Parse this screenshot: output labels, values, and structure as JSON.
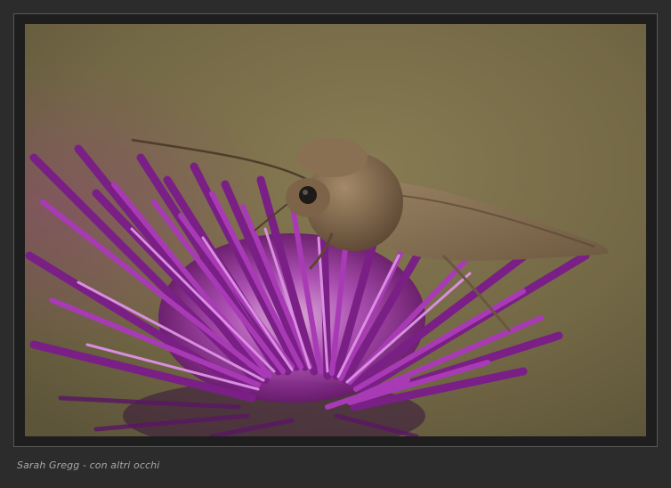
{
  "photo": {
    "subject": "moth on purple thistle flower",
    "colors": {
      "background_bokeh": "#7a6e4a",
      "flower_purple": "#9b2fa6",
      "flower_highlight": "#d080d8",
      "moth_body": "#7c6448",
      "moth_wing": "#8d7558"
    }
  },
  "caption": {
    "credit_text": "Sarah Gregg - con altri occhi"
  },
  "theme": {
    "page_bg": "#2c2c2c",
    "frame_border": "#595959",
    "caption_color": "#a7a7a7"
  }
}
